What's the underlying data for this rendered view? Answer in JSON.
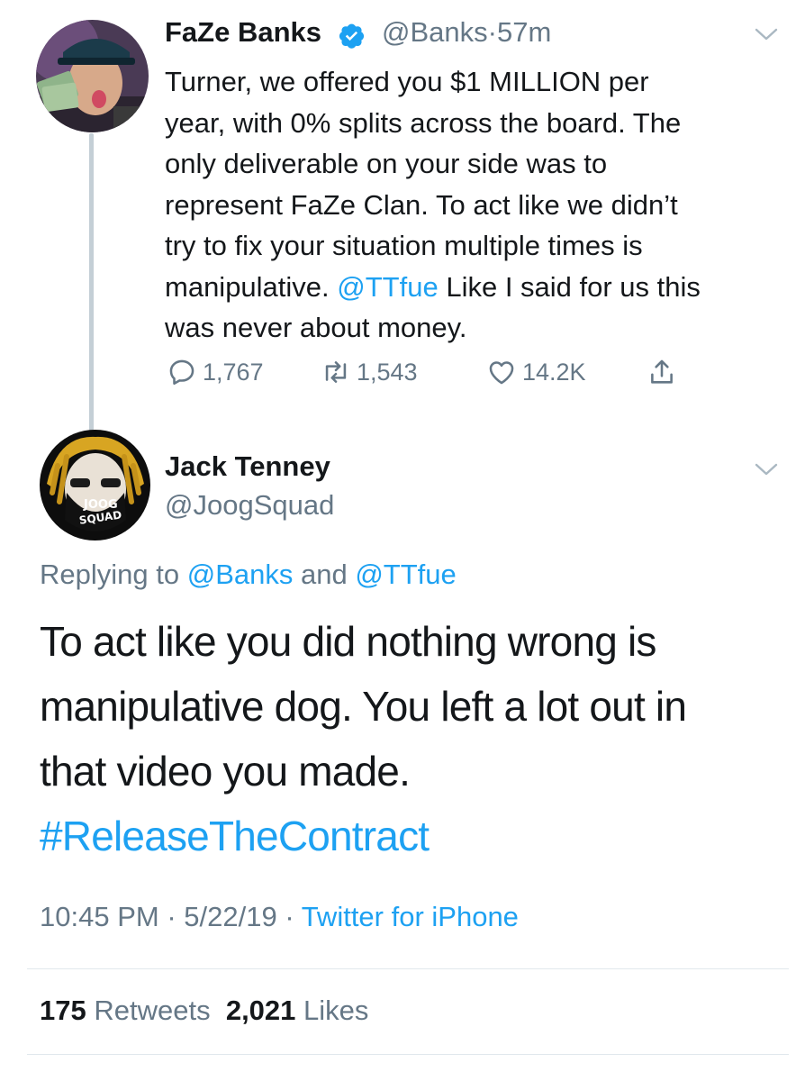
{
  "parent_tweet": {
    "author_name": "FaZe Banks",
    "handle": "@Banks",
    "separator": "·",
    "time": "57m",
    "text_lines": {
      "l1": "Turner, we offered you $1 MILLION per",
      "l2": "year, with 0% splits across the board. The",
      "l3": "only deliverable on your side was to",
      "l4": "represent FaZe Clan. To act like we didn’t",
      "l5": "try to fix your situation multiple times is",
      "l6_a": "manipulative. ",
      "l6_mention": "@TTfue",
      "l6_b": " Like I said for us this",
      "l7": "was never about money."
    },
    "actions": {
      "replies": "1,767",
      "retweets": "1,543",
      "likes": "14.2K"
    }
  },
  "reply_tweet": {
    "author_name": "Jack Tenney",
    "handle": "@JoogSquad",
    "avatar_text": {
      "top": "JOOG",
      "bottom": "SQUAD"
    },
    "replying_to": {
      "prefix": "Replying to ",
      "user1": "@Banks",
      "joiner": " and ",
      "user2": "@TTfue"
    },
    "text_lines": {
      "l1": "To act like you did nothing wrong is",
      "l2": "manipulative dog. You left a lot out in",
      "l3": "that video you made.",
      "hashtag": "#ReleaseTheContract"
    },
    "meta": {
      "time": "10:45 PM",
      "dot1": " · ",
      "date": "5/22/19",
      "dot2": " · ",
      "source": "Twitter for iPhone"
    },
    "stats": {
      "retweets_count": "175",
      "retweets_label": "Retweets",
      "likes_count": "2,021",
      "likes_label": "Likes"
    }
  },
  "colors": {
    "link": "#1da1f2",
    "muted": "#657786",
    "text": "#14171a",
    "thread_line": "#c4cfd6",
    "divider": "#e1e8ed"
  }
}
